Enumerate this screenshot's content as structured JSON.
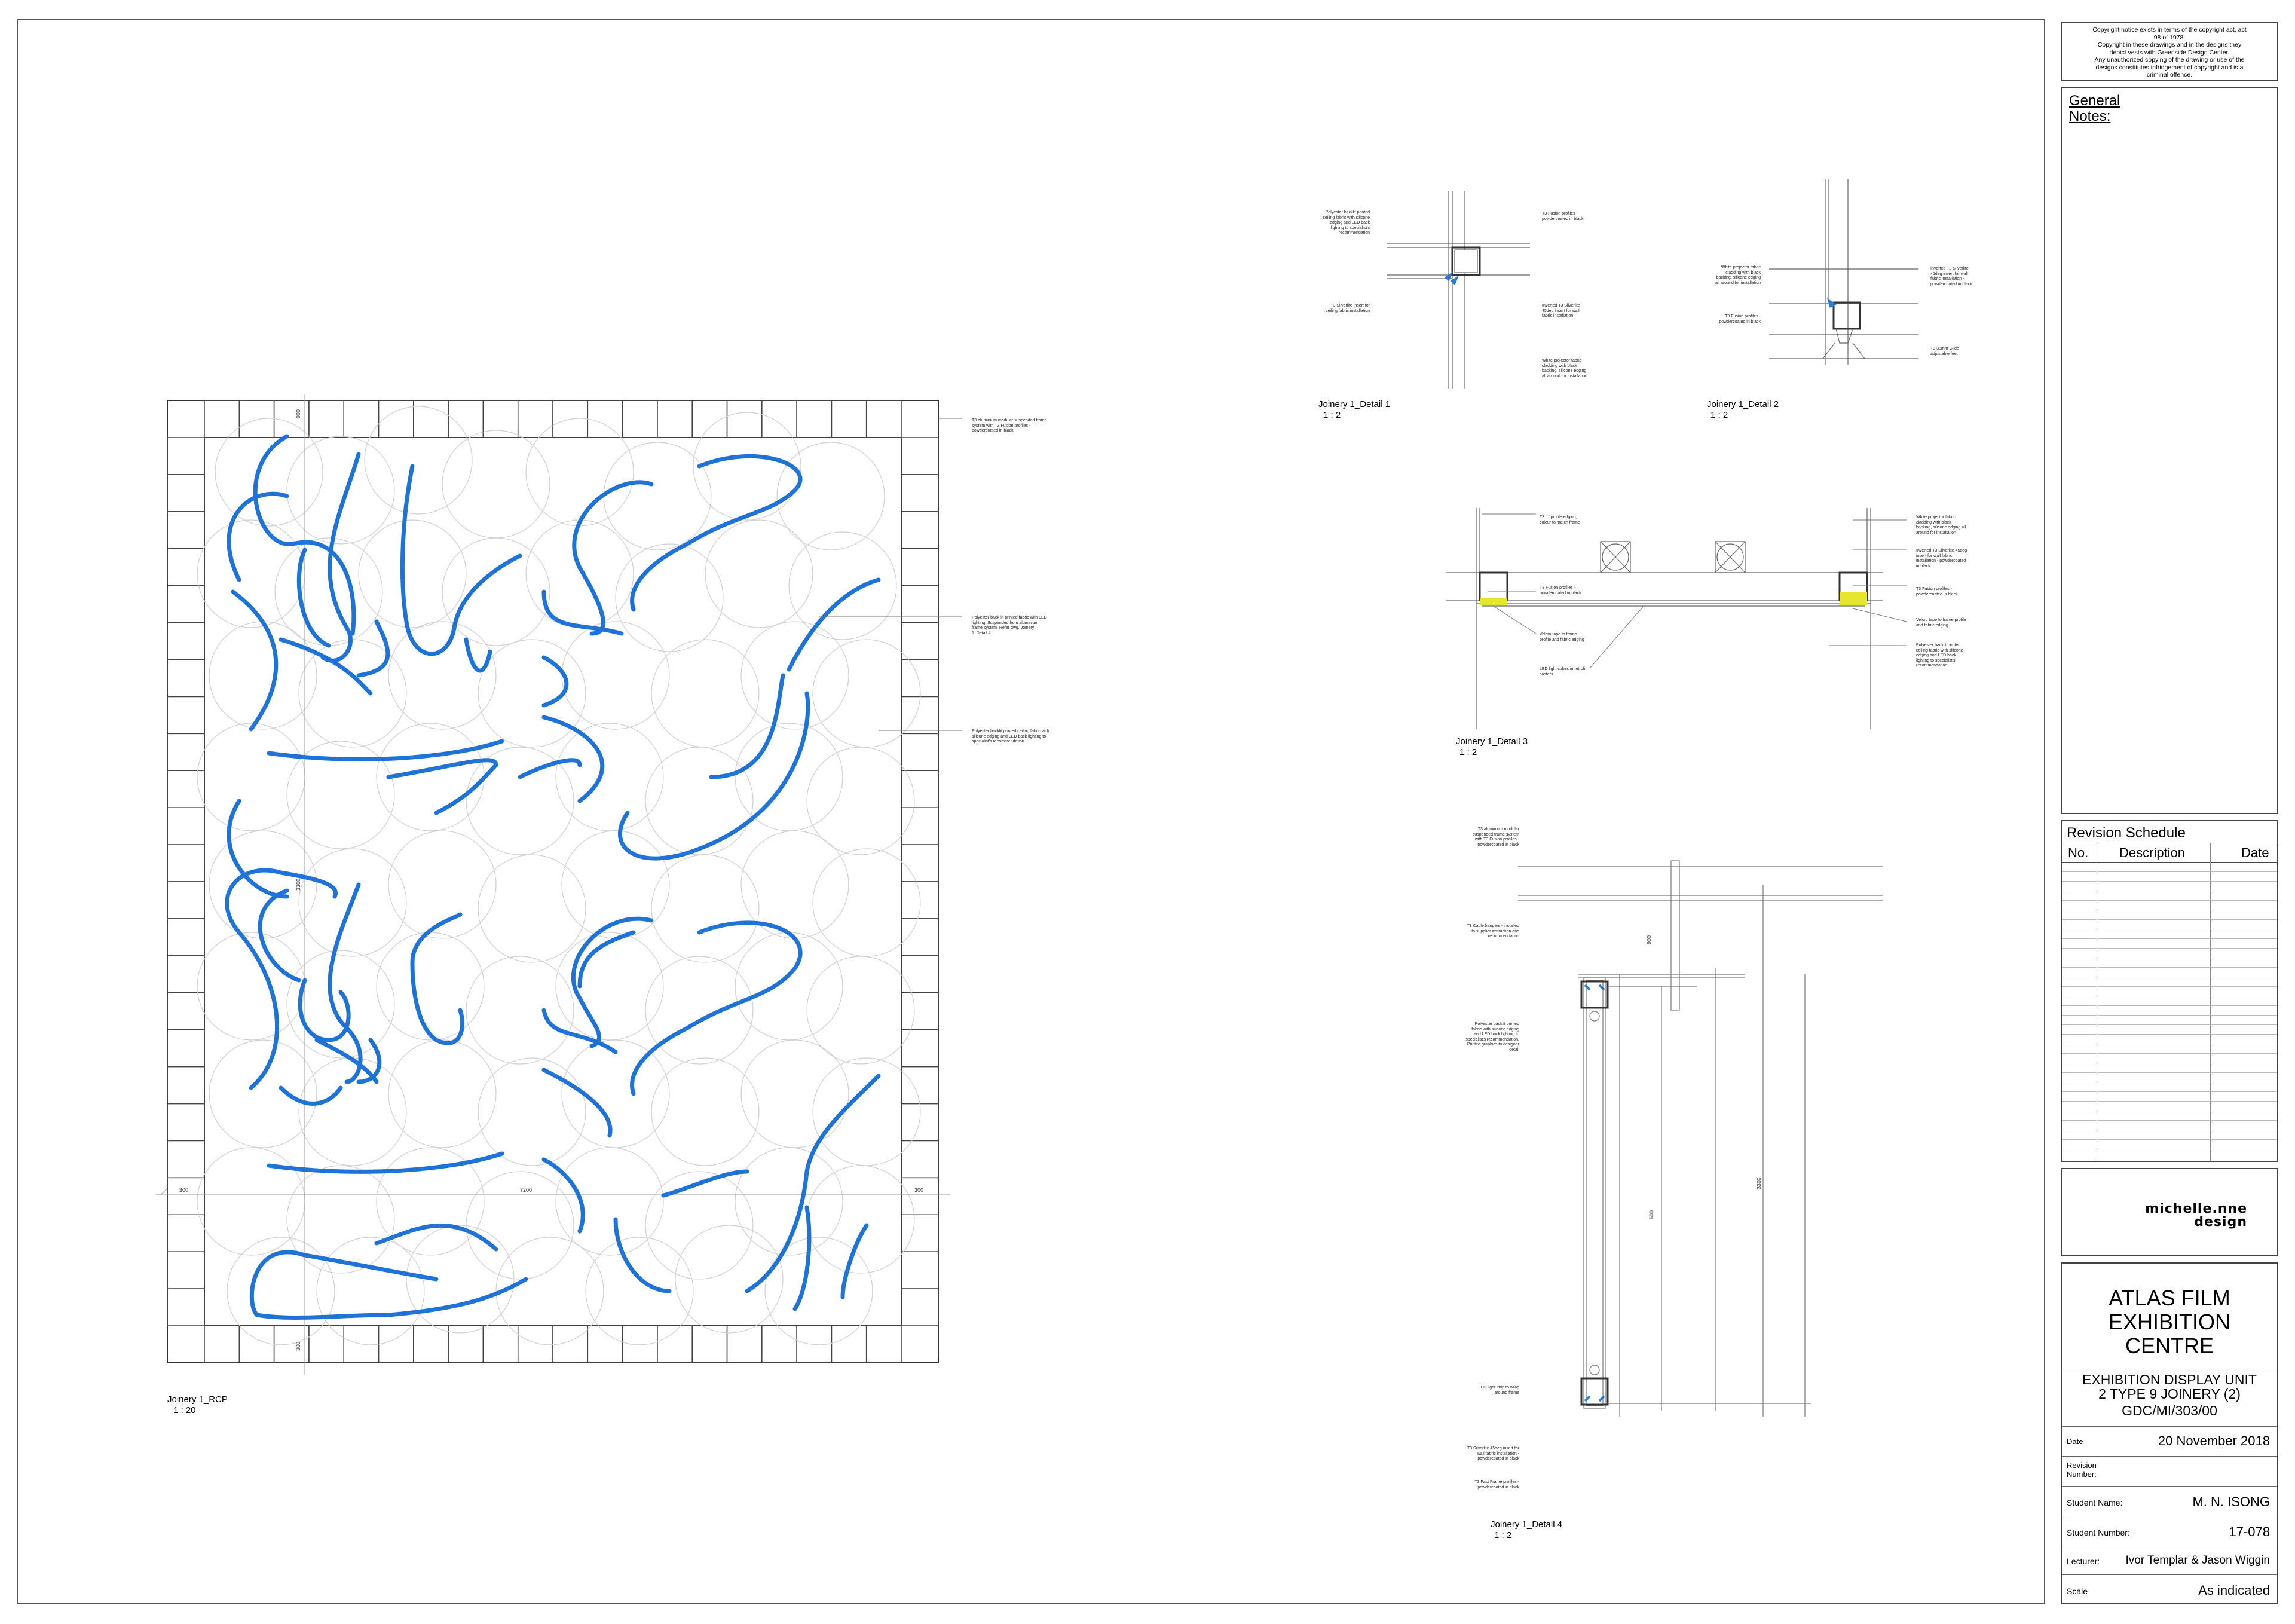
{
  "copyright": [
    "Copyright notice exists in terms of the copyright act, act",
    "98 of 1978.",
    "Copyright in these drawings and in the designs they",
    "depict vests with Greenside Design Center.",
    "Any unauthorized copying of the drawing or use of the",
    "designs constitutes infringement of copyright and is a",
    "criminal offence."
  ],
  "general_notes": {
    "line1": "General",
    "line2": "Notes:"
  },
  "revision_schedule": {
    "title": "Revision Schedule",
    "col_no": "No.",
    "col_description": "Description",
    "col_date": "Date"
  },
  "logo": {
    "line1": "michelle.nne",
    "line2": "design"
  },
  "project": {
    "title_line1": "ATLAS FILM",
    "title_line2": "EXHIBITION",
    "title_line3": "CENTRE",
    "sheet_line1": "EXHIBITION DISPLAY UNIT",
    "sheet_line2": "2 TYPE 9 JOINERY (2)",
    "drawing_no": "GDC/MI/303/00"
  },
  "fields": {
    "date_label": "Date",
    "date_value": "20 November 2018",
    "revision_label_1": "Revision",
    "revision_label_2": "Number:",
    "student_name_label": "Student Name:",
    "student_name_value": "M. N. ISONG",
    "student_number_label": "Student Number:",
    "student_number_value": "17-078",
    "lecturer_label": "Lecturer:",
    "lecturer_value": "Ivor Templar & Jason Wiggin",
    "scale_label": "Scale",
    "scale_value": "As indicated"
  },
  "drawings": {
    "rcp": {
      "name": "Joinery 1_RCP",
      "scale": "1 : 20"
    },
    "detail1": {
      "name": "Joinery 1_Detail 1",
      "scale": "1 : 2"
    },
    "detail2": {
      "name": "Joinery 1_Detail 2",
      "scale": "1 : 2"
    },
    "detail3": {
      "name": "Joinery 1_Detail 3",
      "scale": "1 : 2"
    },
    "detail4": {
      "name": "Joinery 1_Detail 4",
      "scale": "1 : 2"
    }
  },
  "dimensions": {
    "rcp_top": "900",
    "rcp_side": "3300",
    "rcp_width": "7200",
    "rcp_left": "300",
    "rcp_right": "300",
    "rcp_bottom": "300"
  },
  "callouts": {
    "rcp_1": "T3 aluminium modular suspended frame system with T3 Fusion profiles - powdercoated in black",
    "rcp_2": "Polyester back-lit printed fabric with LED lighting. Suspended from aluminium frame system. Refer dwg. Joinery 1_Detail 4",
    "rcp_3": "Polyester backlit printed ceiling fabric with silicone edging and LED back lighting to specialist's recommendation",
    "d1_1": "Polyester backlit printed ceiling fabric with silicone edging and LED back lighting to specialist's recommendation",
    "d1_2": "T3 Fusion profiles - powdercoated in black",
    "d1_3": "T3 Silverlite insert for ceiling fabric installation",
    "d1_4": "Inverted T3 Silverlite 45deg insert for wall fabric installation",
    "d1_5": "White projector fabric cladding with black backing, silicone edging all around for installation",
    "d2_1": "White projector fabric cladding with black backing, silicone edging all around for installation",
    "d2_2": "Inverted T3 Silverlite 45deg insert for wall fabric installation - powdercoated in black",
    "d2_3": "T3 Fusion profiles - powdercoated in black",
    "d2_4": "T3 38mm Glide adjustable feet",
    "d3_1": "T3 'L' profile edging, colour to match frame",
    "d3_2": "T3 Fusion profiles - powdercoated in black",
    "d3_3": "Velcro tape to frame profile and fabric edging",
    "d3_4": "LED light cubes in retrofit casters",
    "d3_5": "White projector fabric cladding with black backing, silicone edging all around for installation",
    "d3_6": "Inverted T3 Silverlite 45deg insert for wall fabric installation - powdercoated in black",
    "d3_7": "T3 Fusion profiles - powdercoated in black",
    "d3_8": "Velcro tape to frame profile and fabric edging",
    "d3_9": "Polyester backlit printed ceiling fabric with silicone edging and LED back lighting to specialist's recommendation",
    "d4_1": "T3 aluminium modular suspended frame system with T3 Fusion profiles - powdercoated in black",
    "d4_2": "T3 Cable hangers - installed to supplier instruction and recommendation",
    "d4_3": "Polyester backlit printed fabric with silicone edging and LED back lighting to specialist's recommendation. Printed graphics to designer detail",
    "d4_4": "LED light strip to wrap around frame",
    "d4_5": "T3 Silverlite 45deg insert for wall fabric installation - powdercoated in black",
    "d4_6": "T3 Fast Frame profiles - powdercoated in black",
    "d4_dim1": "900",
    "d4_dim2": "600",
    "d4_dim3": "3300"
  },
  "colors": {
    "curve_blue": "#1f73d6",
    "highlight_yellow": "#e6e62e",
    "line_grey": "#9a9a9a"
  }
}
